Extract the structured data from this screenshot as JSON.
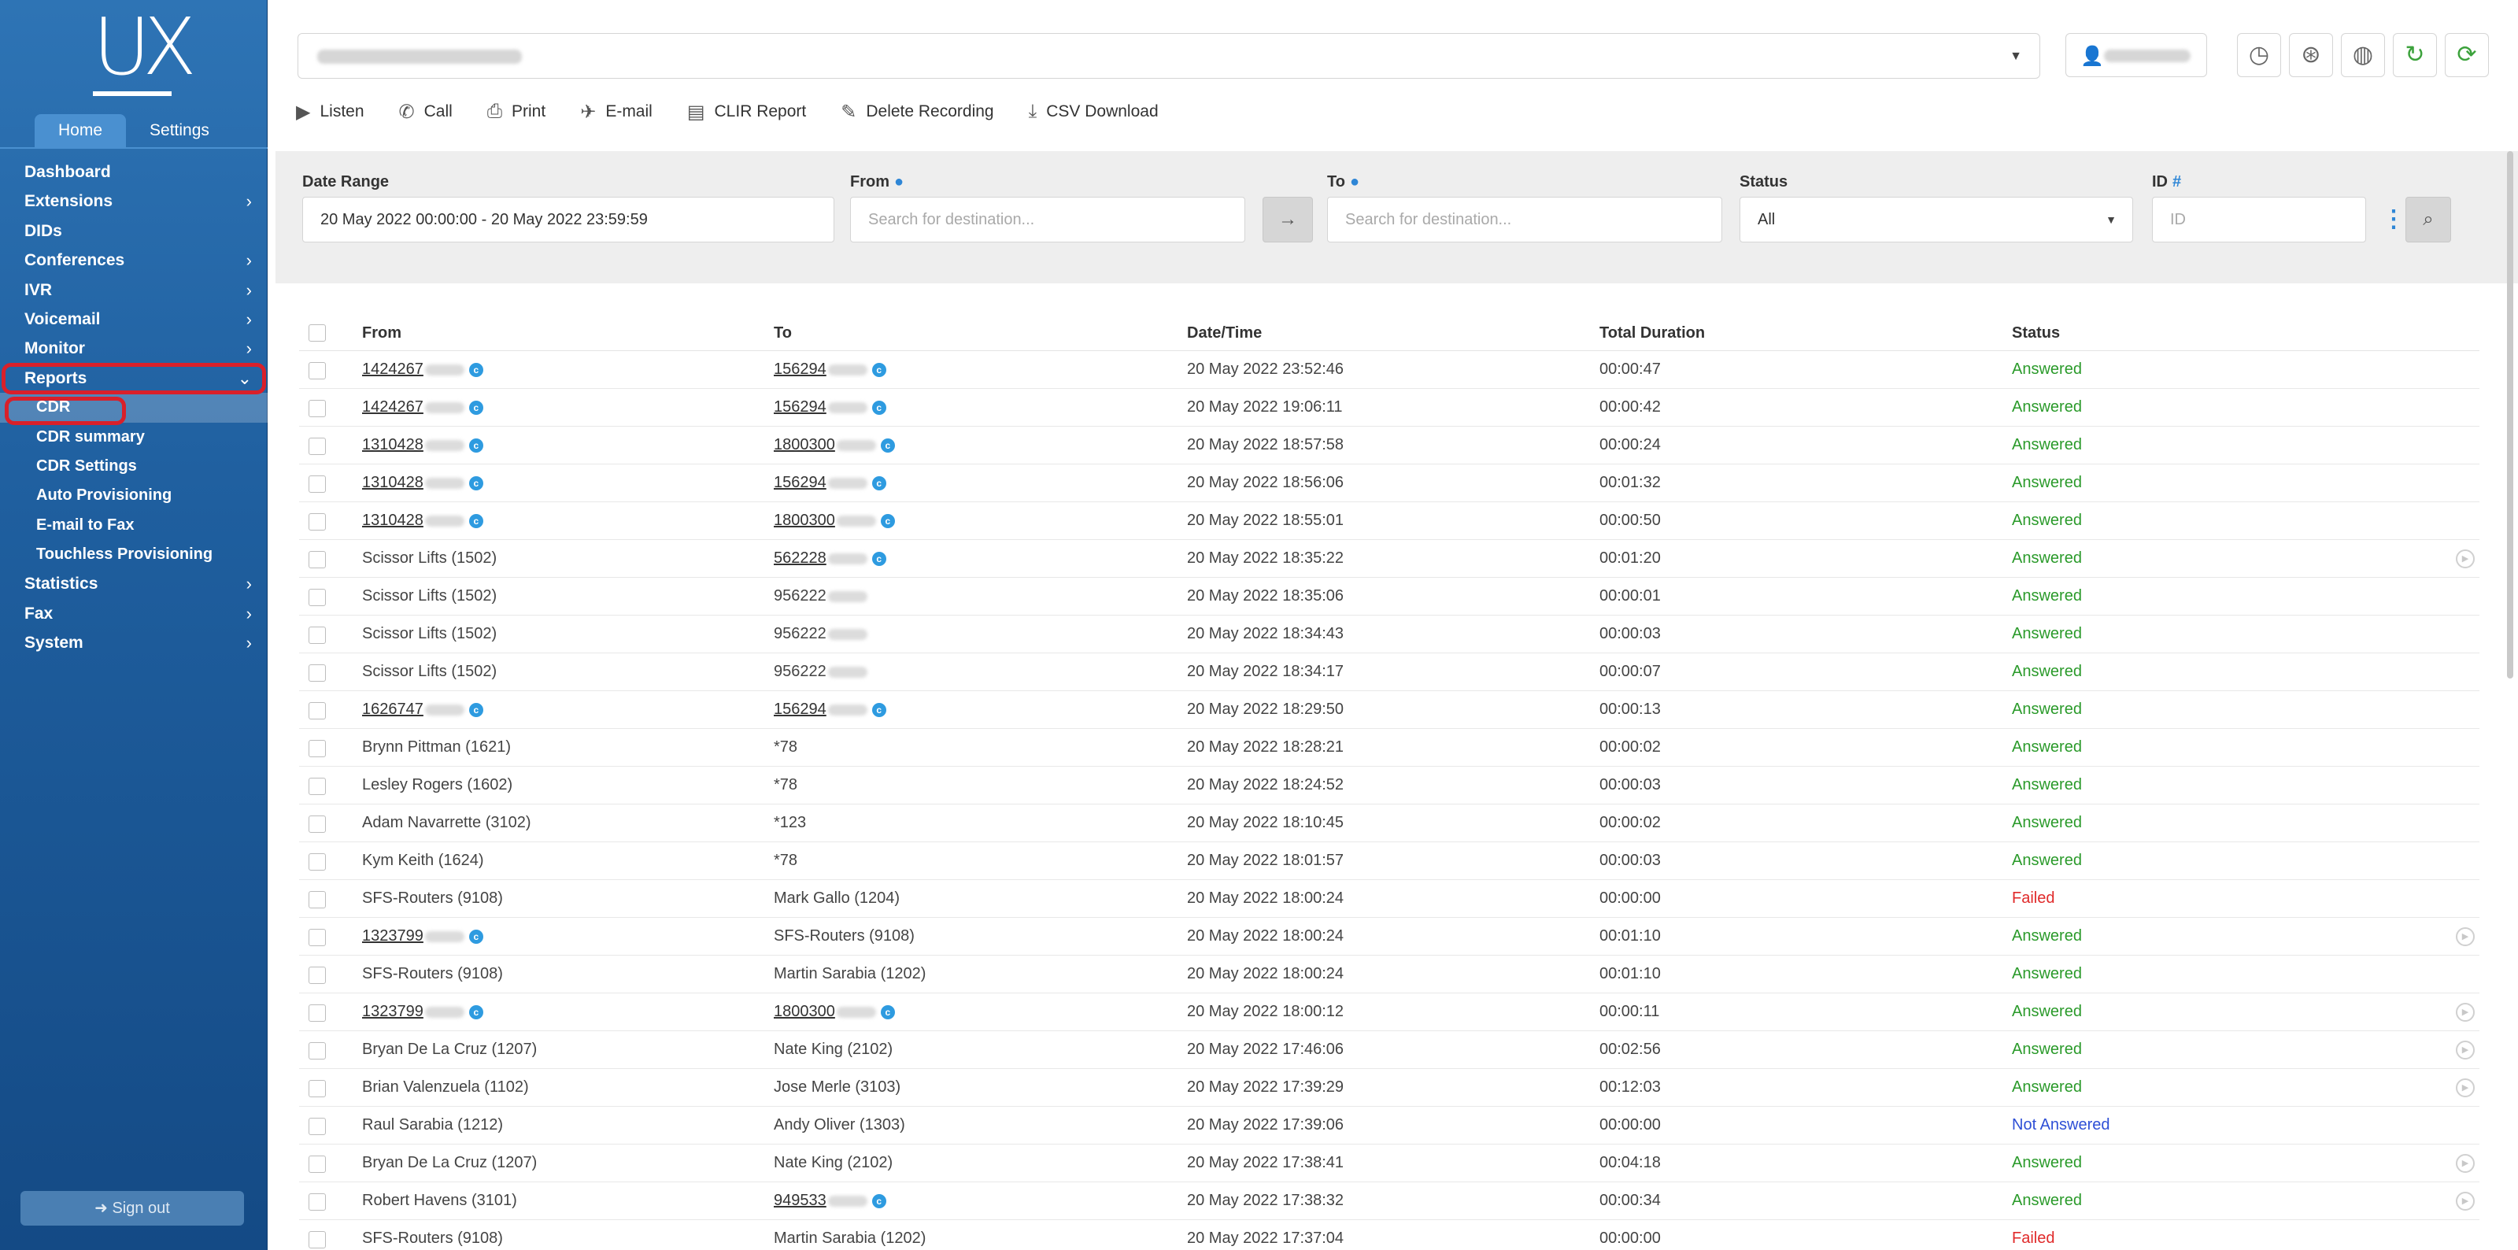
{
  "brand": {
    "logo": "UX"
  },
  "sidebar_tabs": [
    {
      "label": "Home",
      "active": true
    },
    {
      "label": "Settings",
      "active": false
    }
  ],
  "nav": {
    "dashboard": "Dashboard",
    "extensions": "Extensions",
    "dids": "DIDs",
    "conferences": "Conferences",
    "ivr": "IVR",
    "voicemail": "Voicemail",
    "monitor": "Monitor",
    "reports": "Reports",
    "reports_sub": {
      "cdr": "CDR",
      "cdr_summary": "CDR summary",
      "cdr_settings": "CDR Settings",
      "auto_provisioning": "Auto Provisioning",
      "email_to_fax": "E-mail to Fax",
      "touchless_provisioning": "Touchless Provisioning"
    },
    "statistics": "Statistics",
    "fax": "Fax",
    "system": "System",
    "sign_out": "Sign out"
  },
  "toolbar": {
    "listen": "Listen",
    "call": "Call",
    "print": "Print",
    "email": "E-mail",
    "clir_report": "CLIR Report",
    "delete_recording": "Delete Recording",
    "csv_download": "CSV Download"
  },
  "filters": {
    "date_range_label": "Date Range",
    "date_range_value": "20 May 2022 00:00:00 - 20 May 2022 23:59:59",
    "from_label": "From",
    "from_placeholder": "Search for destination...",
    "to_label": "To",
    "to_placeholder": "Search for destination...",
    "status_label": "Status",
    "status_value": "All",
    "id_label": "ID",
    "id_placeholder": "ID"
  },
  "table": {
    "headers": {
      "from": "From",
      "to": "To",
      "datetime": "Date/Time",
      "duration": "Total Duration",
      "status": "Status"
    },
    "rows": [
      {
        "from": "1424267",
        "from_link": true,
        "to": "156294",
        "to_link": true,
        "datetime": "20 May 2022 23:52:46",
        "duration": "00:00:47",
        "status": "Answered",
        "play": false
      },
      {
        "from": "1424267",
        "from_link": true,
        "to": "156294",
        "to_link": true,
        "datetime": "20 May 2022 19:06:11",
        "duration": "00:00:42",
        "status": "Answered",
        "play": false
      },
      {
        "from": "1310428",
        "from_link": true,
        "to": "1800300",
        "to_link": true,
        "datetime": "20 May 2022 18:57:58",
        "duration": "00:00:24",
        "status": "Answered",
        "play": false
      },
      {
        "from": "1310428",
        "from_link": true,
        "to": "156294",
        "to_link": true,
        "datetime": "20 May 2022 18:56:06",
        "duration": "00:01:32",
        "status": "Answered",
        "play": false
      },
      {
        "from": "1310428",
        "from_link": true,
        "to": "1800300",
        "to_link": true,
        "datetime": "20 May 2022 18:55:01",
        "duration": "00:00:50",
        "status": "Answered",
        "play": false
      },
      {
        "from": "Scissor Lifts (1502)",
        "from_link": false,
        "to": "562228",
        "to_link": true,
        "datetime": "20 May 2022 18:35:22",
        "duration": "00:01:20",
        "status": "Answered",
        "play": true
      },
      {
        "from": "Scissor Lifts (1502)",
        "from_link": false,
        "to": "956222",
        "to_link": false,
        "datetime": "20 May 2022 18:35:06",
        "duration": "00:00:01",
        "status": "Answered",
        "play": false
      },
      {
        "from": "Scissor Lifts (1502)",
        "from_link": false,
        "to": "956222",
        "to_link": false,
        "datetime": "20 May 2022 18:34:43",
        "duration": "00:00:03",
        "status": "Answered",
        "play": false
      },
      {
        "from": "Scissor Lifts (1502)",
        "from_link": false,
        "to": "956222",
        "to_link": false,
        "datetime": "20 May 2022 18:34:17",
        "duration": "00:00:07",
        "status": "Answered",
        "play": false
      },
      {
        "from": "1626747",
        "from_link": true,
        "to": "156294",
        "to_link": true,
        "datetime": "20 May 2022 18:29:50",
        "duration": "00:00:13",
        "status": "Answered",
        "play": false
      },
      {
        "from": "Brynn Pittman (1621)",
        "from_link": false,
        "to": "*78",
        "to_link": false,
        "datetime": "20 May 2022 18:28:21",
        "duration": "00:00:02",
        "status": "Answered",
        "play": false
      },
      {
        "from": "Lesley Rogers (1602)",
        "from_link": false,
        "to": "*78",
        "to_link": false,
        "datetime": "20 May 2022 18:24:52",
        "duration": "00:00:03",
        "status": "Answered",
        "play": false
      },
      {
        "from": "Adam Navarrette (3102)",
        "from_link": false,
        "to": "*123",
        "to_link": false,
        "datetime": "20 May 2022 18:10:45",
        "duration": "00:00:02",
        "status": "Answered",
        "play": false
      },
      {
        "from": "Kym Keith (1624)",
        "from_link": false,
        "to": "*78",
        "to_link": false,
        "datetime": "20 May 2022 18:01:57",
        "duration": "00:00:03",
        "status": "Answered",
        "play": false
      },
      {
        "from": "SFS-Routers (9108)",
        "from_link": false,
        "to": "Mark Gallo (1204)",
        "to_link": false,
        "datetime": "20 May 2022 18:00:24",
        "duration": "00:00:00",
        "status": "Failed",
        "play": false
      },
      {
        "from": "1323799",
        "from_link": true,
        "to": "SFS-Routers (9108)",
        "to_link": false,
        "datetime": "20 May 2022 18:00:24",
        "duration": "00:01:10",
        "status": "Answered",
        "play": true
      },
      {
        "from": "SFS-Routers (9108)",
        "from_link": false,
        "to": "Martin Sarabia (1202)",
        "to_link": false,
        "datetime": "20 May 2022 18:00:24",
        "duration": "00:01:10",
        "status": "Answered",
        "play": false
      },
      {
        "from": "1323799",
        "from_link": true,
        "to": "1800300",
        "to_link": true,
        "datetime": "20 May 2022 18:00:12",
        "duration": "00:00:11",
        "status": "Answered",
        "play": true
      },
      {
        "from": "Bryan De La Cruz (1207)",
        "from_link": false,
        "to": "Nate King (2102)",
        "to_link": false,
        "datetime": "20 May 2022 17:46:06",
        "duration": "00:02:56",
        "status": "Answered",
        "play": true
      },
      {
        "from": "Brian Valenzuela (1102)",
        "from_link": false,
        "to": "Jose Merle (3103)",
        "to_link": false,
        "datetime": "20 May 2022 17:39:29",
        "duration": "00:12:03",
        "status": "Answered",
        "play": true
      },
      {
        "from": "Raul Sarabia (1212)",
        "from_link": false,
        "to": "Andy Oliver (1303)",
        "to_link": false,
        "datetime": "20 May 2022 17:39:06",
        "duration": "00:00:00",
        "status": "Not Answered",
        "play": false
      },
      {
        "from": "Bryan De La Cruz (1207)",
        "from_link": false,
        "to": "Nate King (2102)",
        "to_link": false,
        "datetime": "20 May 2022 17:38:41",
        "duration": "00:04:18",
        "status": "Answered",
        "play": true
      },
      {
        "from": "Robert Havens (3101)",
        "from_link": false,
        "to": "949533",
        "to_link": true,
        "datetime": "20 May 2022 17:38:32",
        "duration": "00:00:34",
        "status": "Answered",
        "play": true
      },
      {
        "from": "SFS-Routers (9108)",
        "from_link": false,
        "to": "Martin Sarabia (1202)",
        "to_link": false,
        "datetime": "20 May 2022 17:37:04",
        "duration": "00:00:00",
        "status": "Failed",
        "play": false
      }
    ]
  }
}
